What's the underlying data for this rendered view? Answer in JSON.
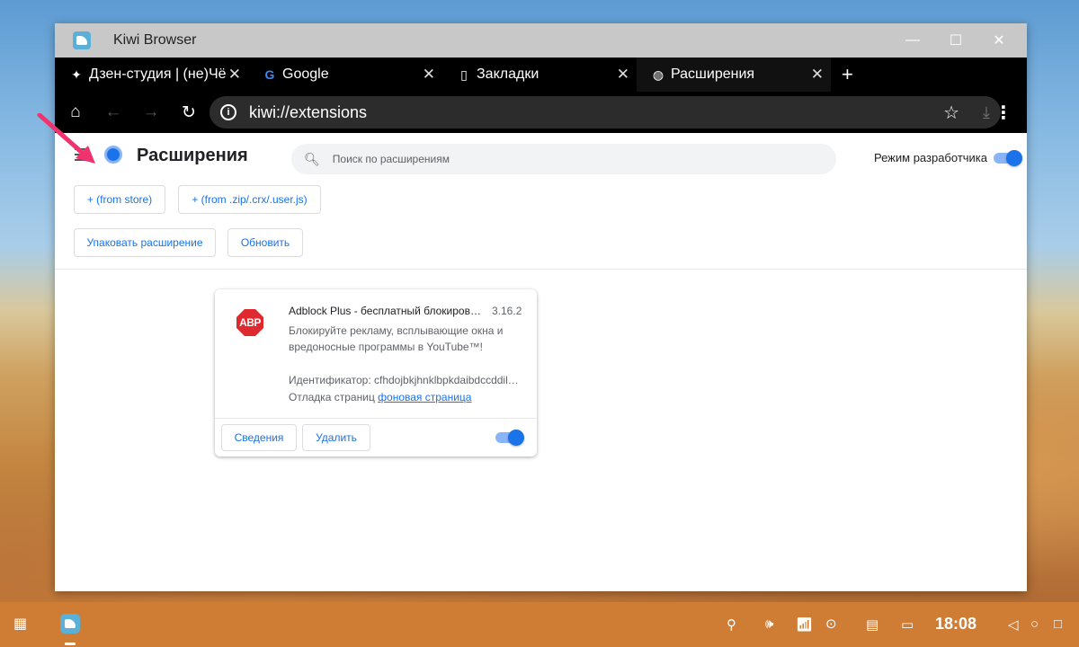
{
  "window": {
    "title": "Kiwi Browser",
    "controls": {
      "minimize": "—",
      "maximize": "☐",
      "close": "✕"
    }
  },
  "tabs": [
    {
      "label": "Дзен-студия | (не)Чё",
      "icon": "sparkle-icon"
    },
    {
      "label": "Google",
      "icon": "google-icon"
    },
    {
      "label": "Закладки",
      "icon": "page-icon"
    },
    {
      "label": "Расширения",
      "icon": "globe-icon"
    }
  ],
  "toolbar": {
    "url": "kiwi://extensions"
  },
  "extensions_page": {
    "title": "Расширения",
    "search_placeholder": "Поиск по расширениям",
    "dev_mode_label": "Режим разработчика",
    "dev_mode_on": true,
    "buttons": {
      "from_store": "+ (from store)",
      "from_zip": "+ (from .zip/.crx/.user.js)",
      "pack": "Упаковать расширение",
      "update": "Обновить"
    }
  },
  "extension_card": {
    "icon_text": "ABP",
    "name": "Adblock Plus - бесплатный блокировщик рекламы",
    "version": "3.16.2",
    "description": "Блокируйте рекламу, всплывающие окна и вредоносные программы в YouTube™!",
    "id_label": "Идентификатор: cfhdojbkjhnklbpkdaibdccddilifddb",
    "debug_label": "Отладка страниц",
    "debug_link": "фоновая страница",
    "details_button": "Сведения",
    "remove_button": "Удалить",
    "enabled": true
  },
  "taskbar": {
    "time": "18:08"
  }
}
